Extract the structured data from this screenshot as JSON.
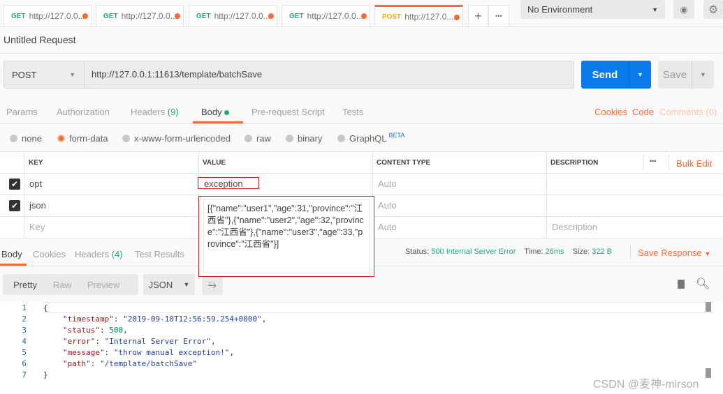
{
  "tabs": [
    {
      "method": "GET",
      "label": "http://127.0.0..."
    },
    {
      "method": "GET",
      "label": "http://127.0.0..."
    },
    {
      "method": "GET",
      "label": "http://127.0.0..."
    },
    {
      "method": "GET",
      "label": "http://127.0.0..."
    },
    {
      "method": "POST",
      "label": "http://127.0...."
    }
  ],
  "new_tab": "+",
  "more_tabs": "•••",
  "environment": "No Environment",
  "request_title": "Untitled Request",
  "method": "POST",
  "url": "http://127.0.0.1:11613/template/batchSave",
  "send": "Send",
  "save": "Save",
  "req_tabs": {
    "params": "Params",
    "authorization": "Authorization",
    "headers": "Headers",
    "headers_count": "(9)",
    "body": "Body",
    "prerequest": "Pre-request Script",
    "tests": "Tests"
  },
  "right_links": {
    "cookies": "Cookies",
    "code": "Code",
    "comments": "Comments (0)"
  },
  "body_types": {
    "none": "none",
    "form_data": "form-data",
    "urlencoded": "x-www-form-urlencoded",
    "raw": "raw",
    "binary": "binary",
    "graphql": "GraphQL",
    "beta": "BETA"
  },
  "table": {
    "headers": {
      "key": "KEY",
      "value": "VALUE",
      "content_type": "CONTENT TYPE",
      "description": "DESCRIPTION"
    },
    "bulk_edit": "Bulk Edit",
    "more": "•••",
    "rows": [
      {
        "key": "opt",
        "value": "exception",
        "content_type": "Auto"
      },
      {
        "key": "json",
        "value": "",
        "content_type": "Auto"
      }
    ],
    "placeholder": {
      "key": "Key",
      "content_type": "Auto",
      "description": "Description"
    }
  },
  "json_popup": "[{\"name\":\"user1\",\"age\":31,\"province\":\"江西省\"},{\"name\":\"user2\",\"age\":32,\"province\":\"江西省\"},{\"name\":\"user3\",\"age\":33,\"province\":\"江西省\"}]",
  "resp_tabs": {
    "body": "Body",
    "cookies": "Cookies",
    "headers": "Headers",
    "headers_count": "(4)",
    "test_results": "Test Results"
  },
  "status": {
    "status_label": "Status:",
    "status": "500 Internal Server Error",
    "time_label": "Time:",
    "time": "26ms",
    "size_label": "Size:",
    "size": "322 B",
    "save_response": "Save Response"
  },
  "view": {
    "pretty": "Pretty",
    "raw": "Raw",
    "preview": "Preview",
    "format": "JSON"
  },
  "code_lines": [
    "1",
    "2",
    "3",
    "4",
    "5",
    "6",
    "7"
  ],
  "response": {
    "open": "{",
    "timestamp_k": "\"timestamp\"",
    "timestamp_v": "\"2019-09-10T12:56:59.254+0000\"",
    "status_k": "\"status\"",
    "status_v": "500",
    "error_k": "\"error\"",
    "error_v": "\"Internal Server Error\"",
    "message_k": "\"message\"",
    "message_v": "\"throw manual exception!\"",
    "path_k": "\"path\"",
    "path_v": "\"/template/batchSave\"",
    "close": "}"
  },
  "watermark": "CSDN @麦神-mirson"
}
